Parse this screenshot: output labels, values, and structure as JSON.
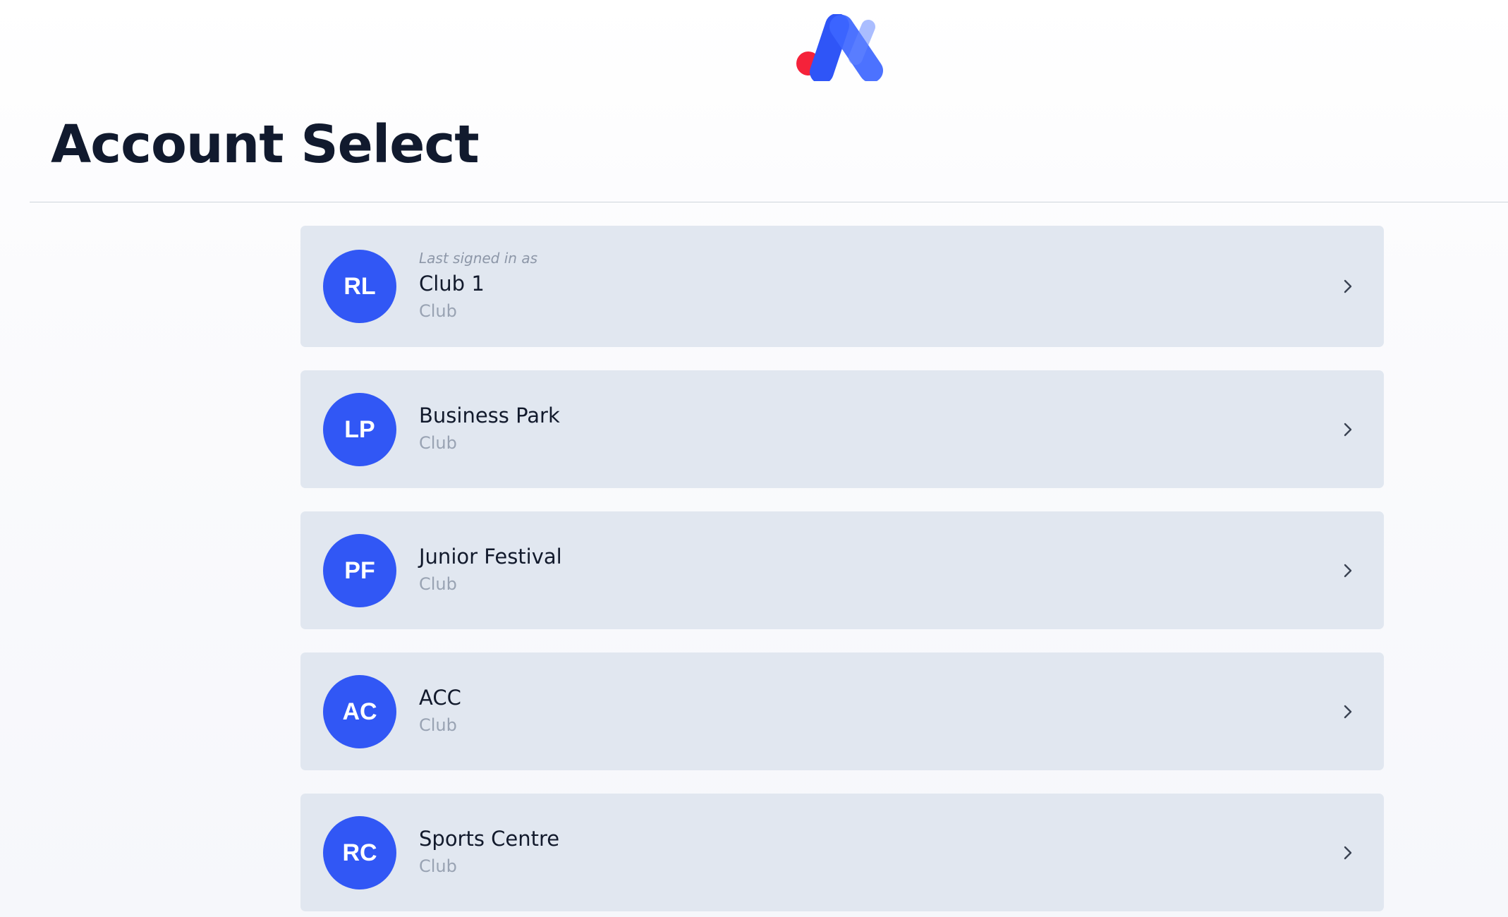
{
  "header": {
    "logo_icon": "brand-logo-icon",
    "title": "Account Select"
  },
  "colors": {
    "brand_blue": "#3157f5",
    "brand_red": "#f5223a",
    "card_background": "#e1e7f0",
    "title_text": "#111a2e",
    "muted_text": "#99a3b3"
  },
  "accounts": [
    {
      "initials": "RL",
      "last_signed_label": "Last signed in as",
      "name": "Club 1",
      "type": "Club",
      "icon": "chevron-right-icon"
    },
    {
      "initials": "LP",
      "name": "Business Park",
      "type": "Club",
      "icon": "chevron-right-icon"
    },
    {
      "initials": "PF",
      "name": "Junior Festival",
      "type": "Club",
      "icon": "chevron-right-icon"
    },
    {
      "initials": "AC",
      "name": "ACC",
      "type": "Club",
      "icon": "chevron-right-icon"
    },
    {
      "initials": "RC",
      "name": "Sports Centre",
      "type": "Club",
      "icon": "chevron-right-icon"
    }
  ]
}
